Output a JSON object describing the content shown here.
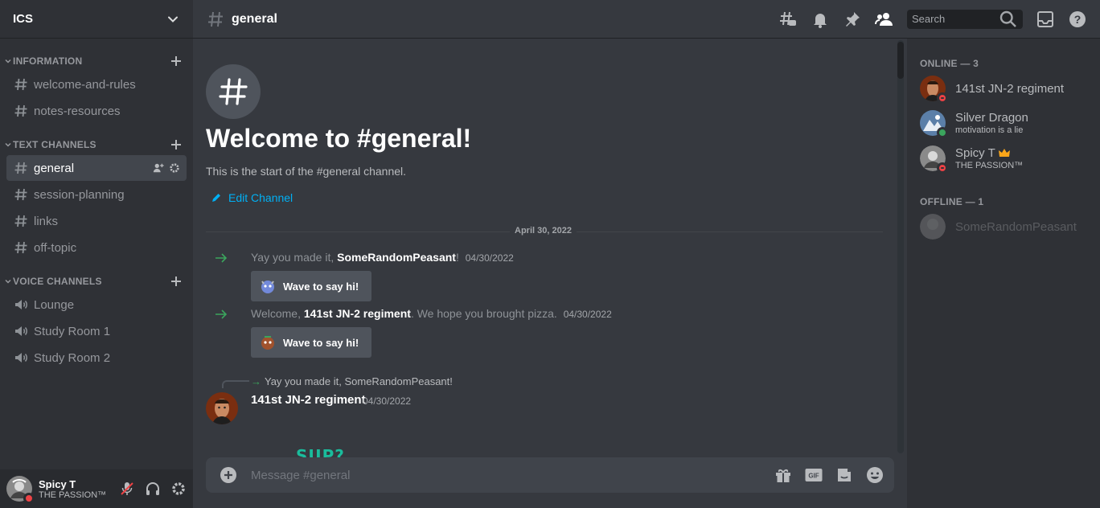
{
  "server": {
    "name": "ICS"
  },
  "categories": [
    {
      "label": "INFORMATION",
      "channels": [
        "welcome-and-rules",
        "notes-resources"
      ]
    },
    {
      "label": "TEXT CHANNELS",
      "channels": [
        "general",
        "session-planning",
        "links",
        "off-topic"
      ]
    },
    {
      "label": "VOICE CHANNELS",
      "channels": [
        "Lounge",
        "Study Room 1",
        "Study Room 2"
      ]
    }
  ],
  "current_channel": "general",
  "user": {
    "name": "Spicy T",
    "status": "THE PASSION™"
  },
  "topbar": {
    "search_placeholder": "Search"
  },
  "welcome": {
    "title": "Welcome to #general!",
    "subtitle": "This is the start of the #general channel.",
    "edit_label": "Edit Channel"
  },
  "date_divider": "April 30, 2022",
  "system_messages": [
    {
      "prefix": "Yay you made it, ",
      "name": "SomeRandomPeasant",
      "suffix": "!",
      "time": "04/30/2022",
      "button": "Wave to say hi!"
    },
    {
      "prefix": "Welcome, ",
      "name": "141st JN-2 regiment",
      "suffix": ". We hope you brought pizza.",
      "time": "04/30/2022",
      "button": "Wave to say hi!"
    }
  ],
  "reply": {
    "referenced_text": "Yay you made it, SomeRandomPeasant!",
    "author": "141st JN-2 regiment",
    "time": "04/30/2022",
    "sticker_text": "SUP?"
  },
  "composer": {
    "placeholder": "Message #general"
  },
  "members": {
    "online_label": "ONLINE — 3",
    "offline_label": "OFFLINE — 1",
    "online": [
      {
        "name": "141st JN-2 regiment",
        "status_text": "",
        "presence": "dnd"
      },
      {
        "name": "Silver Dragon",
        "status_text": "motivation is a lie",
        "presence": "online"
      },
      {
        "name": "Spicy T",
        "status_text": "THE PASSION™",
        "presence": "dnd",
        "owner": true
      }
    ],
    "offline": [
      {
        "name": "SomeRandomPeasant"
      }
    ]
  },
  "colors": {
    "accent_link": "#00b0f4",
    "online": "#3ba55d",
    "dnd": "#ed4245",
    "background": "#36393f",
    "sidebar": "#2f3136"
  },
  "icons": [
    "chevron-down-icon",
    "hash-icon",
    "speaker-icon",
    "plus-icon",
    "threads-icon",
    "bell-icon",
    "pin-icon",
    "members-icon",
    "search-icon",
    "inbox-icon",
    "help-icon",
    "gift-icon",
    "gif-icon",
    "sticker-icon",
    "emoji-icon",
    "mic-muted-icon",
    "headphones-icon",
    "gear-icon",
    "pencil-icon",
    "arrow-right-icon",
    "crown-icon"
  ]
}
